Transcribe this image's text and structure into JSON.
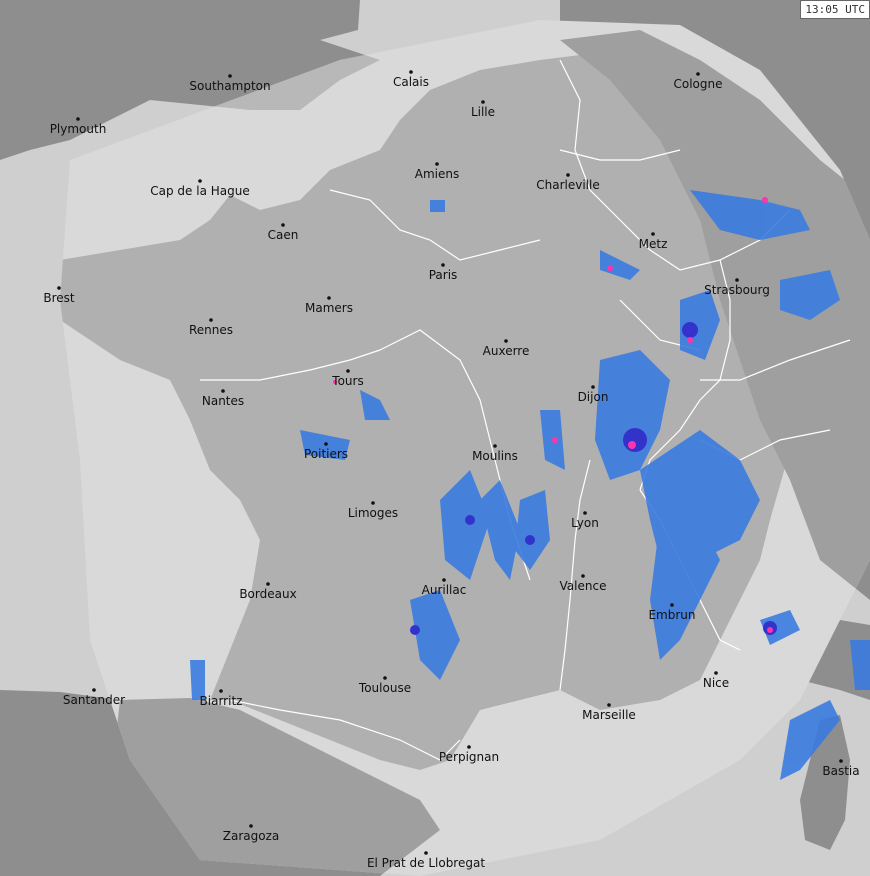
{
  "timestamp": "13:05 UTC",
  "colors": {
    "sea": "#d6d6d6",
    "land_outside": "#8c8c8c",
    "land_inside": "#adadad",
    "sea_outside": "#9a9a9a",
    "borders": "#ffffff",
    "precip_light": "#3a7be0",
    "precip_medium": "#3355dd",
    "precip_heavy": "#9922cc",
    "precip_extreme": "#ff33aa"
  },
  "cities": [
    {
      "name": "Southampton",
      "id": "southampton"
    },
    {
      "name": "Plymouth",
      "id": "plymouth"
    },
    {
      "name": "Calais",
      "id": "calais"
    },
    {
      "name": "Lille",
      "id": "lille"
    },
    {
      "name": "Cologne",
      "id": "cologne"
    },
    {
      "name": "Amiens",
      "id": "amiens"
    },
    {
      "name": "Charleville",
      "id": "charleville"
    },
    {
      "name": "Cap de la Hague",
      "id": "cap-de-la-hague"
    },
    {
      "name": "Caen",
      "id": "caen"
    },
    {
      "name": "Metz",
      "id": "metz"
    },
    {
      "name": "Paris",
      "id": "paris"
    },
    {
      "name": "Brest",
      "id": "brest"
    },
    {
      "name": "Strasbourg",
      "id": "strasbourg"
    },
    {
      "name": "Mamers",
      "id": "mamers"
    },
    {
      "name": "Rennes",
      "id": "rennes"
    },
    {
      "name": "Auxerre",
      "id": "auxerre"
    },
    {
      "name": "Tours",
      "id": "tours"
    },
    {
      "name": "Dijon",
      "id": "dijon"
    },
    {
      "name": "Nantes",
      "id": "nantes"
    },
    {
      "name": "Poitiers",
      "id": "poitiers"
    },
    {
      "name": "Moulins",
      "id": "moulins"
    },
    {
      "name": "Limoges",
      "id": "limoges"
    },
    {
      "name": "Lyon",
      "id": "lyon"
    },
    {
      "name": "Aurillac",
      "id": "aurillac"
    },
    {
      "name": "Valence",
      "id": "valence"
    },
    {
      "name": "Bordeaux",
      "id": "bordeaux"
    },
    {
      "name": "Embrun",
      "id": "embrun"
    },
    {
      "name": "Toulouse",
      "id": "toulouse"
    },
    {
      "name": "Nice",
      "id": "nice"
    },
    {
      "name": "Santander",
      "id": "santander"
    },
    {
      "name": "Biarritz",
      "id": "biarritz"
    },
    {
      "name": "Marseille",
      "id": "marseille"
    },
    {
      "name": "Perpignan",
      "id": "perpignan"
    },
    {
      "name": "Bastia",
      "id": "bastia"
    },
    {
      "name": "Zaragoza",
      "id": "zaragoza"
    },
    {
      "name": "El Prat de Llobregat",
      "id": "el-prat-de-llobregat"
    }
  ]
}
